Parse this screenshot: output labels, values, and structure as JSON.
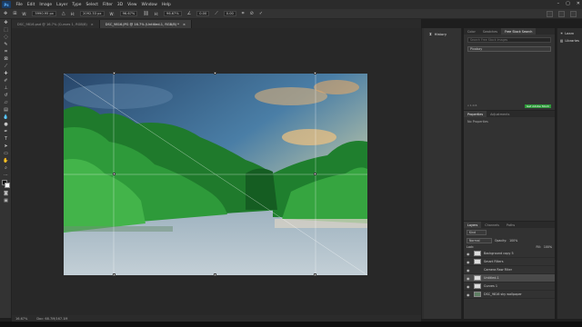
{
  "menu": {
    "logo": "Ps",
    "items": [
      "File",
      "Edit",
      "Image",
      "Layer",
      "Type",
      "Select",
      "Filter",
      "3D",
      "View",
      "Window",
      "Help"
    ]
  },
  "options": {
    "width_label": "W:",
    "width_value": "5990.95 px",
    "height_label": "H:",
    "height_value": "2092.33 px",
    "scale_w": "96.67%",
    "scale_h": "96.67%",
    "angle": "0.00",
    "h_skew": "0.00"
  },
  "tabs": [
    {
      "label": "DSC_9816.psd @ 16.7% (Curves 1, RGB/8)",
      "close": "×",
      "active": false
    },
    {
      "label": "DSC_9816.JPG @ 16.7% (Untitled-1, RGB/8) *",
      "close": "×",
      "active": true
    }
  ],
  "status": {
    "zoom": "16.67%",
    "doc": "Doc: 68.7M/167.1M"
  },
  "history_panel": {
    "label": "History"
  },
  "libraries_panel": {
    "label": "Libraries"
  },
  "top_panel": {
    "tabs": [
      "Color",
      "Swatches",
      "Free Stock Search"
    ],
    "search_placeholder": "Search Free Stock Images",
    "source": "Pixabay",
    "version": "v 1.0.6",
    "link": "Get Adobe Stock"
  },
  "properties_panel": {
    "tabs": [
      "Properties",
      "Adjustments"
    ],
    "empty": "No Properties"
  },
  "layers_panel": {
    "tabs": [
      "Layers",
      "Channels",
      "Paths"
    ],
    "kind": "Kind",
    "blend": "Normal",
    "opacity_label": "Opacity:",
    "opacity_value": "100%",
    "fill_label": "Fill:",
    "fill_value": "100%",
    "lock_label": "Lock:",
    "layers": [
      {
        "name": "Background copy 5",
        "selected": false
      },
      {
        "name": "Smart Filters",
        "selected": false
      },
      {
        "name": "Camera Raw Filter",
        "selected": false
      },
      {
        "name": "Untitled-1",
        "selected": true
      },
      {
        "name": "Curves 1",
        "selected": false
      },
      {
        "name": "DSC_9816 sky wallpaper",
        "selected": false
      }
    ]
  },
  "colors": {
    "accent": "#1473e6",
    "panel": "#323232",
    "workspace": "#282828"
  }
}
